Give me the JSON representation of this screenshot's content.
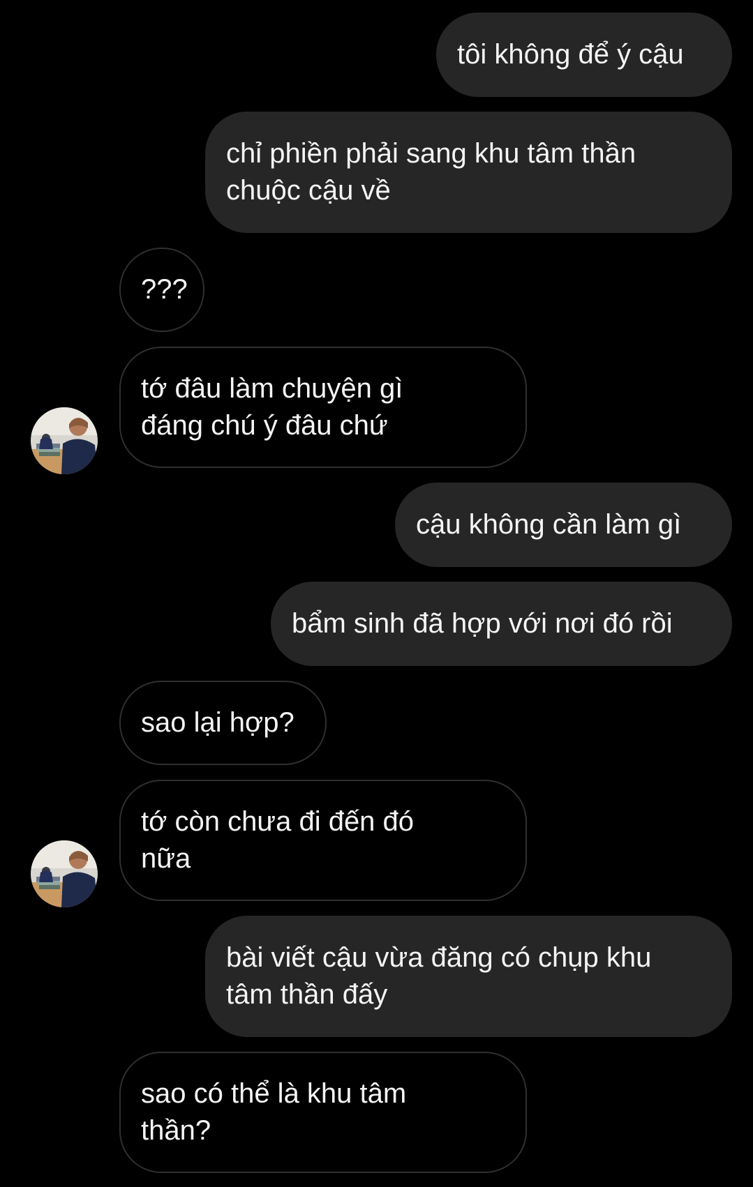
{
  "conversation": {
    "messages": [
      {
        "id": "m1",
        "side": "sent",
        "text": "tôi không để ý cậu"
      },
      {
        "id": "m2",
        "side": "sent",
        "text": "chỉ phiền phải sang khu tâm thần\nchuộc cậu về"
      },
      {
        "id": "m3",
        "side": "received",
        "text": "???"
      },
      {
        "id": "m4",
        "side": "received",
        "text": "tớ đâu làm chuyện gì\nđáng chú ý đâu chứ"
      },
      {
        "id": "m5",
        "side": "sent",
        "text": "cậu không cần làm gì"
      },
      {
        "id": "m6",
        "side": "sent",
        "text": "bẩm sinh đã hợp với nơi đó rồi"
      },
      {
        "id": "m7",
        "side": "received",
        "text": "sao lại hợp?"
      },
      {
        "id": "m8",
        "side": "received",
        "text": "tớ còn chưa đi đến đó\nnữa"
      },
      {
        "id": "m9",
        "side": "sent",
        "text": "bài viết cậu vừa đăng có chụp khu\ntâm thần đấy"
      },
      {
        "id": "m10",
        "side": "received",
        "text": "sao có thể là khu tâm\nthần?"
      }
    ]
  },
  "theme": {
    "background": "#000000",
    "sent_bubble": "#262626",
    "received_border": "#2f2f2f",
    "text": "#f5f5f5"
  },
  "icons": {
    "avatar": "contact-avatar-photo"
  }
}
